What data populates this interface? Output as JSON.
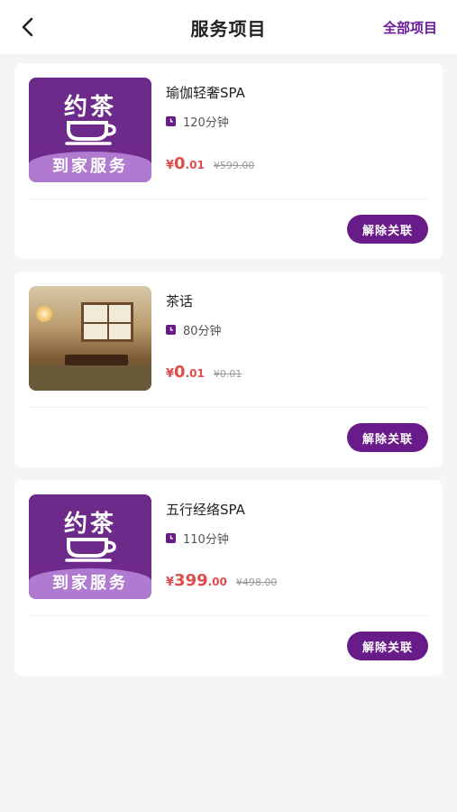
{
  "header": {
    "title": "服务项目",
    "right_link": "全部项目"
  },
  "colors": {
    "accent": "#6a1b8a",
    "price": "#e24b4b",
    "background": "#f5f5f5"
  },
  "services": [
    {
      "name": "瑜伽轻奢SPA",
      "duration": "120分钟",
      "price_symbol": "¥",
      "price_int": "0",
      "price_dec": ".01",
      "original_price": "¥599.00",
      "thumb": "logo",
      "logo_word": "约茶",
      "logo_sub": "到家服务",
      "button": "解除关联"
    },
    {
      "name": "茶话",
      "duration": "80分钟",
      "price_symbol": "¥",
      "price_int": "0",
      "price_dec": ".01",
      "original_price": "¥0.01",
      "thumb": "photo",
      "button": "解除关联"
    },
    {
      "name": "五行经络SPA",
      "duration": "110分钟",
      "price_symbol": "¥",
      "price_int": "399",
      "price_dec": ".00",
      "original_price": "¥498.00",
      "thumb": "logo",
      "logo_word": "约茶",
      "logo_sub": "到家服务",
      "button": "解除关联"
    }
  ]
}
